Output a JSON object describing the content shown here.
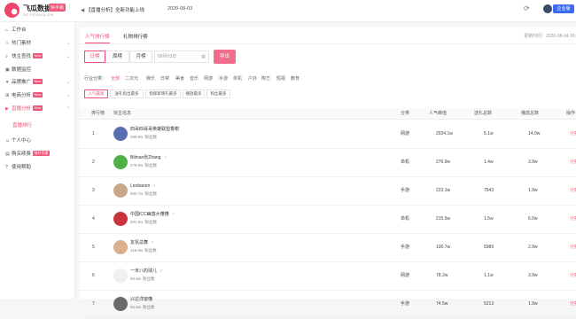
{
  "app": {
    "name": "飞瓜数据",
    "badge": "快手版",
    "domain": "DZ.FEIGUA.CN"
  },
  "header": {
    "notice": "【直播分析】全新功能上线",
    "date": "2020-08-03",
    "business_button": "企业版"
  },
  "sidebar": {
    "items": [
      {
        "label": "工作台",
        "icon": "home-icon",
        "tag": "",
        "chevron": false,
        "active": false
      },
      {
        "label": "热门素材",
        "icon": "fire-icon",
        "tag": "",
        "chevron": true,
        "active": false
      },
      {
        "label": "快主查找",
        "icon": "search-icon",
        "tag": "New",
        "chevron": true,
        "active": false
      },
      {
        "label": "数据监控",
        "icon": "monitor-icon",
        "tag": "",
        "chevron": false,
        "active": false
      },
      {
        "label": "品牌推广",
        "icon": "brand-icon",
        "tag": "New",
        "chevron": true,
        "active": false
      },
      {
        "label": "电商分析",
        "icon": "cart-icon",
        "tag": "New",
        "chevron": true,
        "active": false
      },
      {
        "label": "直播分析",
        "icon": "live-icon",
        "tag": "New",
        "chevron": true,
        "active": true
      },
      {
        "label": "个人中心",
        "icon": "user-icon",
        "tag": "",
        "chevron": false,
        "active": false
      },
      {
        "label": "购买续费",
        "icon": "wallet-icon",
        "tag": "限时优惠",
        "chevron": false,
        "active": false
      },
      {
        "label": "使用帮助",
        "icon": "help-icon",
        "tag": "",
        "chevron": false,
        "active": false
      }
    ],
    "sub_item": "直播排行"
  },
  "tabs": [
    {
      "label": "人气排行榜",
      "active": true
    },
    {
      "label": "礼物排行榜",
      "active": false
    }
  ],
  "update_time": "更新时间：2020-08-04 06:",
  "period": {
    "options": [
      "日榜",
      "周榜",
      "月榜"
    ],
    "selected": "日榜",
    "date_placeholder": "08月03日"
  },
  "export_button": "导出",
  "categories": {
    "label": "行业分类：",
    "items": [
      "全部",
      "二次元",
      "娱乐",
      "日常",
      "美食",
      "音乐",
      "网游",
      "手游",
      "单机",
      "户外",
      "陶艺",
      "短视",
      "教育"
    ],
    "selected": "全部"
  },
  "sort_buttons": [
    {
      "label": "人气最高",
      "active": true
    },
    {
      "label": "送礼指出最多",
      "active": false
    },
    {
      "label": "指挥新增礼最多",
      "active": false
    },
    {
      "label": "播放最多",
      "active": false
    },
    {
      "label": "粉丝最多",
      "active": false
    }
  ],
  "table": {
    "headers": [
      "排行榜",
      "快主信息",
      "分类",
      "人气峰值",
      "送礼总数",
      "播放总数",
      "操作"
    ],
    "fans_label": "粉丝数",
    "rows": [
      {
        "rank": "1",
        "name": "四哥四哥哥英雄联盟香榭",
        "gender": "",
        "fans": "458.8w",
        "category": "网游",
        "popularity": "2934.1w",
        "gifts": "5.1w",
        "plays": "14.0w",
        "op": "分析",
        "avatar_color": "#5a6fb0"
      },
      {
        "rank": "2",
        "name": "Bilman张Zhang",
        "gender": "♂",
        "fans": "276.9w",
        "category": "单机",
        "popularity": "276.9w",
        "gifts": "1.4w",
        "plays": "3.9w",
        "op": "分析",
        "avatar_color": "#4fb04a"
      },
      {
        "rank": "3",
        "name": "Leobanon",
        "gender": "♂",
        "fans": "690.7w",
        "category": "手游",
        "popularity": "223.1w",
        "gifts": "7543",
        "plays": "1.9w",
        "op": "分析",
        "avatar_color": "#c9a98a"
      },
      {
        "rank": "4",
        "name": "中国ICC幽悠大懂懂",
        "gender": "♂",
        "fans": "203.9w",
        "category": "单机",
        "popularity": "215.5w",
        "gifts": "1.5w",
        "plays": "6.0w",
        "op": "分析",
        "avatar_color": "#c8323a"
      },
      {
        "rank": "5",
        "name": "友氛总舞",
        "gender": "♂",
        "fans": "116.9w",
        "category": "手游",
        "popularity": "100.7w",
        "gifts": "5989",
        "plays": "2.9w",
        "op": "分析",
        "avatar_color": "#d8b08c"
      },
      {
        "rank": "6",
        "name": "一米八的球儿",
        "gender": "♂",
        "fans": "56.9w",
        "category": "网游",
        "popularity": "78.2w",
        "gifts": "1.1w",
        "plays": "3.9w",
        "op": "分析",
        "avatar_color": "#f0f0f0"
      },
      {
        "rank": "7",
        "name": "兴达洋窗懂",
        "gender": "",
        "fans": "66.8w",
        "category": "手游",
        "popularity": "74.5w",
        "gifts": "5213",
        "plays": "1.9w",
        "op": "分析",
        "avatar_color": "#6b6b6b"
      }
    ]
  }
}
